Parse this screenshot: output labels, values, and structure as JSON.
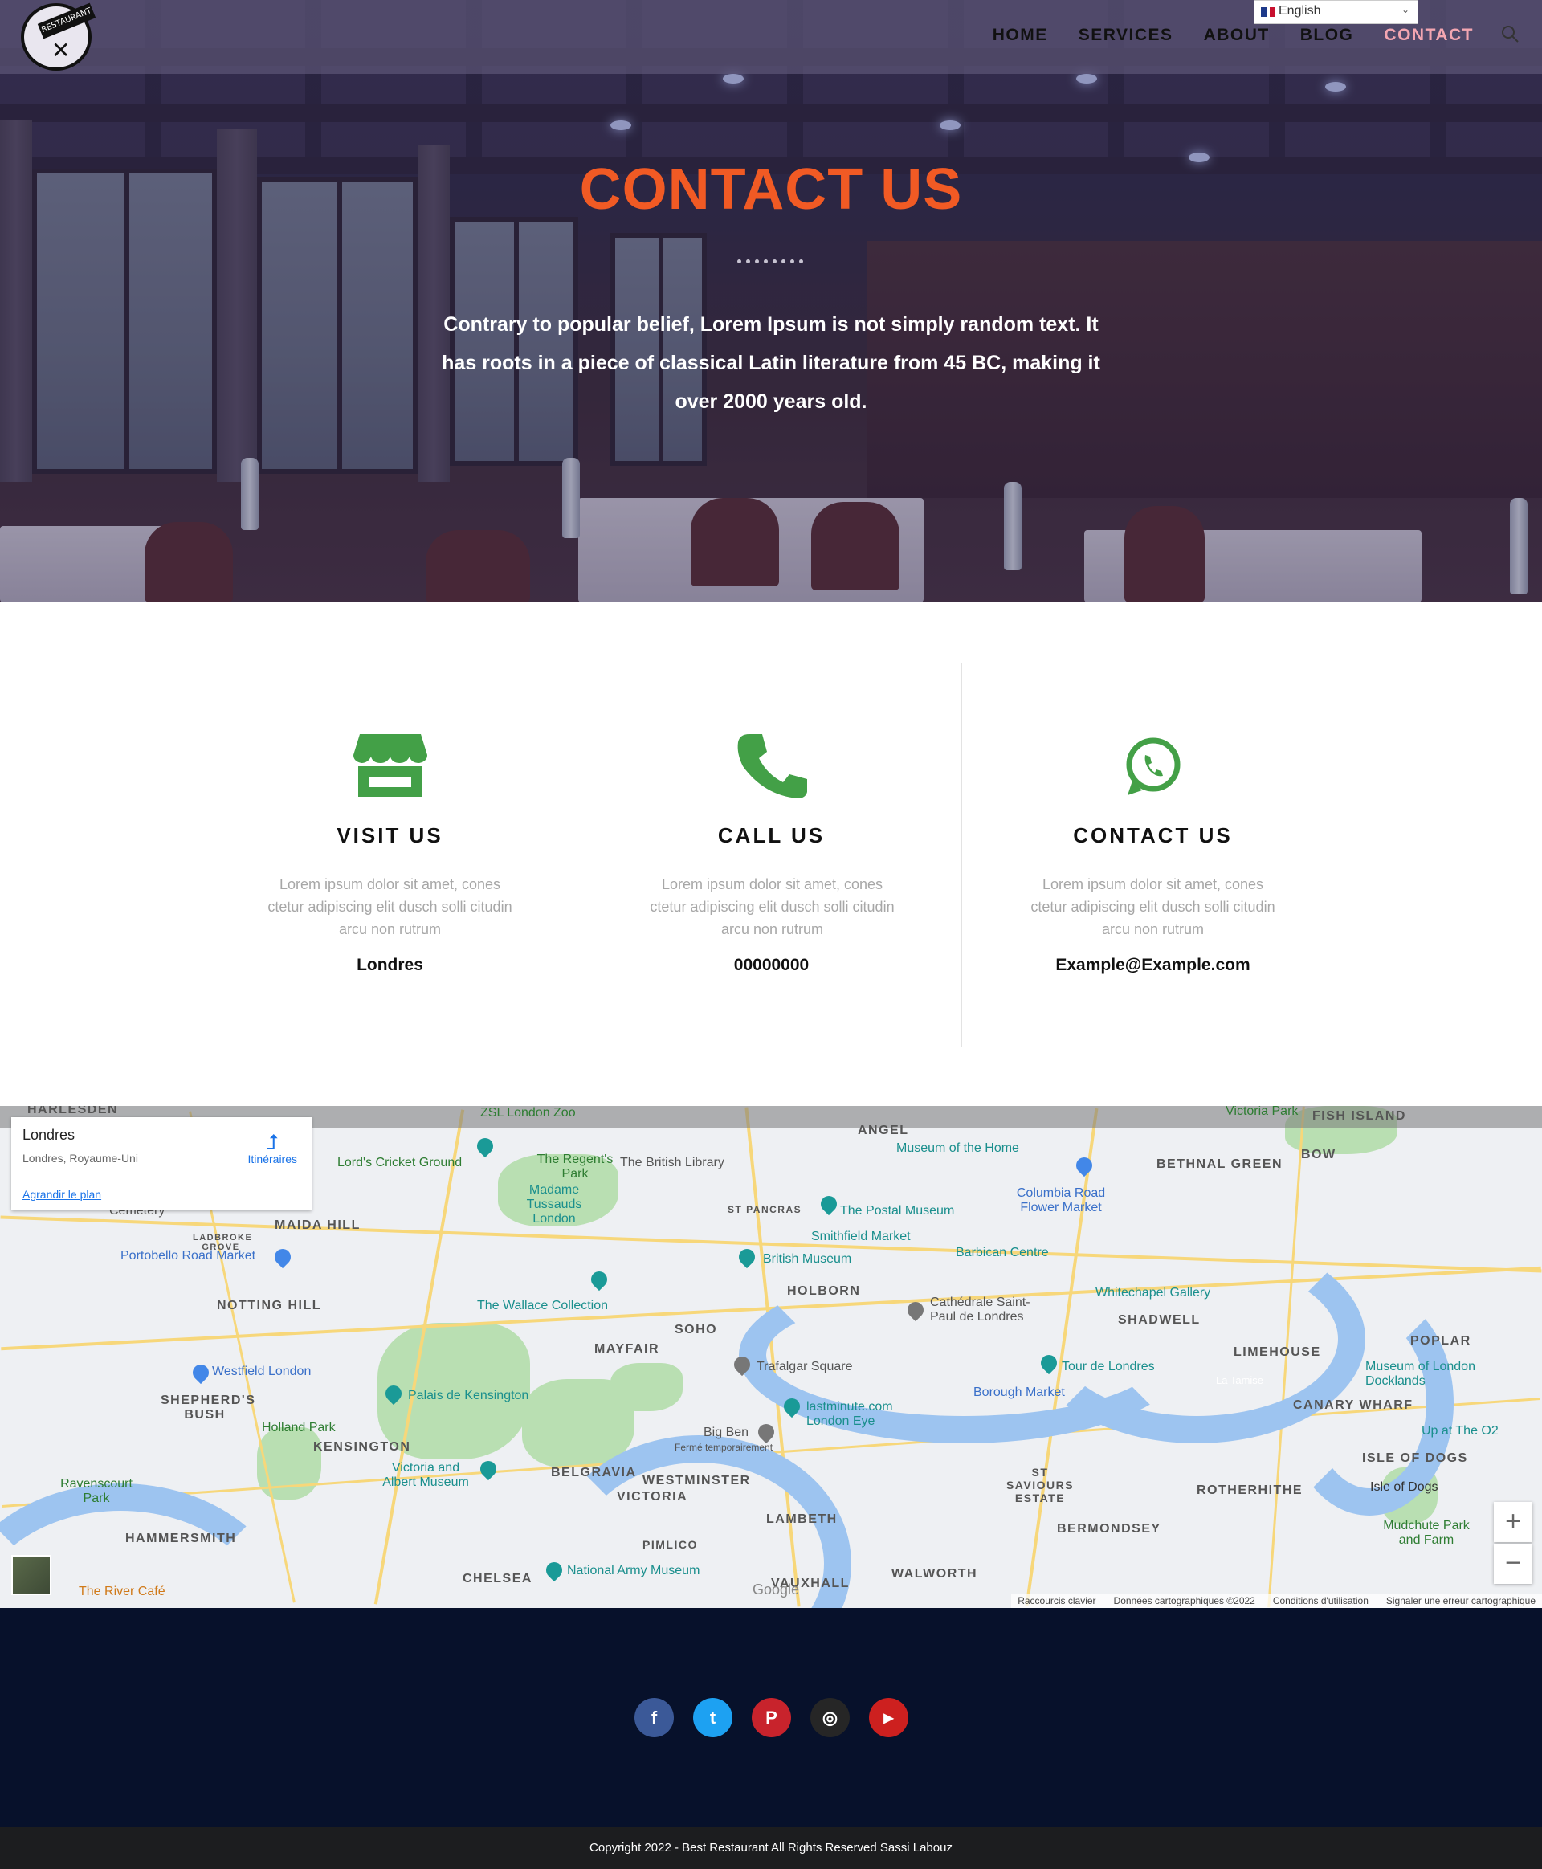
{
  "nav": {
    "items": [
      {
        "label": "HOME"
      },
      {
        "label": "SERVICES"
      },
      {
        "label": "ABOUT"
      },
      {
        "label": "BLOG"
      },
      {
        "label": "CONTACT"
      }
    ],
    "active": "CONTACT",
    "language": "English",
    "logo_text": "RESTAURANT"
  },
  "hero": {
    "title": "CONTACT US",
    "text": "Contrary to popular belief, Lorem Ipsum is not simply random text. It has roots in a piece of classical Latin literature from 45 BC, making it over 2000 years old."
  },
  "contact": {
    "columns": [
      {
        "icon": "store-icon",
        "title": "VISIT US",
        "text": "Lorem ipsum dolor sit amet, cones ctetur adipiscing elit dusch solli citudin arcu non rutrum",
        "value": "Londres"
      },
      {
        "icon": "phone-icon",
        "title": "CALL US",
        "text": "Lorem ipsum dolor sit amet, cones ctetur adipiscing elit dusch solli citudin arcu non rutrum",
        "value": "00000000"
      },
      {
        "icon": "whatsapp-icon",
        "title": "CONTACT US",
        "text": "Lorem ipsum dolor sit amet, cones ctetur adipiscing elit dusch solli citudin arcu non rutrum",
        "value": "Example@Example.com"
      }
    ],
    "accent_color": "#43a047"
  },
  "map": {
    "card": {
      "place": "Londres",
      "address": "Londres, Royaume-Uni",
      "directions": "Itinéraires",
      "enlarge": "Agrandir le plan"
    },
    "labels": {
      "harlesden": "HARLESDEN",
      "zoo": "ZSL London Zoo",
      "angel": "ANGEL",
      "victoria_park": "Victoria Park",
      "fish_island": "FISH ISLAND",
      "lords": "Lord's Cricket Ground",
      "regents": "The Regent's Park",
      "library": "The British Library",
      "madame": "Madame Tussauds London",
      "museum_home": "Museum of the Home",
      "bethnal": "BETHNAL GREEN",
      "bow": "BOW",
      "columbia": "Columbia Road Flower Market",
      "cemetery": "Cemetery",
      "maida": "MAIDA HILL",
      "ladbroke": "LADBROKE GROVE",
      "postal": "The Postal Museum",
      "smithfield": "Smithfield Market",
      "barbican": "Barbican Centre",
      "portobello": "Portobello Road Market",
      "british_museum": "British Museum",
      "holborn": "HOLBORN",
      "notting": "NOTTING HILL",
      "wallace": "The Wallace Collection",
      "soho": "SOHO",
      "mayfair": "MAYFAIR",
      "stpaul": "Cathédrale Saint-Paul de Londres",
      "whitechapel": "Whitechapel Gallery",
      "shadwell": "SHADWELL",
      "limehouse": "LIMEHOUSE",
      "poplar": "POPLAR",
      "westfield": "Westfield London",
      "trafalgar": "Trafalgar Square",
      "tower": "Tour de Londres",
      "docklands": "Museum of London Docklands",
      "shepherds": "SHEPHERD'S BUSH",
      "kensington_palace": "Palais de Kensington",
      "london_eye": "lastminute.com London Eye",
      "borough": "Borough Market",
      "canary": "CANARY WHARF",
      "holland": "Holland Park",
      "kensington": "KENSINGTON",
      "bigben": "Big Ben",
      "bigben_status": "Fermé temporairement",
      "isle": "ISLE OF DOGS",
      "isle2": "Isle of Dogs",
      "o2": "Up at The O2",
      "ravenscourt": "Ravenscourt Park",
      "va": "Victoria and Albert Museum",
      "belgravia": "BELGRAVIA",
      "westminster": "WESTMINSTER",
      "victoria": "VICTORIA",
      "stsaviours": "ST SAVIOURS ESTATE",
      "rotherhithe": "ROTHERHITHE",
      "lambeth": "LAMBETH",
      "bermondsey": "BERMONDSEY",
      "mudchute": "Mudchute Park and Farm",
      "hammersmith": "HAMMERSMITH",
      "chelsea": "CHELSEA",
      "army": "National Army Museum",
      "pimlico": "PIMLICO",
      "vauxhall": "VAUXHALL",
      "walworth": "WALWORTH",
      "river_cafe": "The River Café",
      "tamise": "La Tamise",
      "stpancras": "ST PANCRAS"
    },
    "footer": [
      "Raccourcis clavier",
      "Données cartographiques ©2022",
      "Conditions d'utilisation",
      "Signaler une erreur cartographique"
    ],
    "google": "Google",
    "zoom_in": "+",
    "zoom_out": "−"
  },
  "footer": {
    "socials": [
      {
        "name": "facebook-icon",
        "glyph": "f",
        "color": "#3b5998"
      },
      {
        "name": "twitter-icon",
        "glyph": "t",
        "color": "#1da1f2"
      },
      {
        "name": "pinterest-icon",
        "glyph": "P",
        "color": "#c8232c"
      },
      {
        "name": "instagram-icon",
        "glyph": "◎",
        "color": "#262626"
      },
      {
        "name": "youtube-icon",
        "glyph": "▶",
        "color": "#cd201f"
      }
    ],
    "copyright": "Copyright 2022 - Best Restaurant All Rights Reserved Sassi Labouz"
  }
}
